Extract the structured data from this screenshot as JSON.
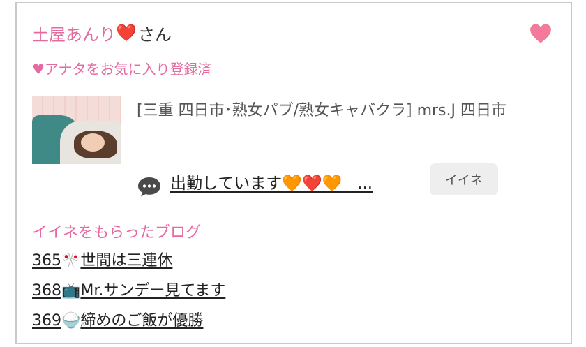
{
  "profile": {
    "name": "土屋あんり",
    "name_emoji": "❤️",
    "suffix": "さん",
    "favorite_status": "♥アナタをお気に入り登録済"
  },
  "shop": {
    "title": "[三重 四日市･熟女パブ/熟女キャバクラ]  mrs.J 四日市"
  },
  "status": {
    "text": "出勤しています🧡❤️🧡   ...",
    "icon": "speech-bubble-icon"
  },
  "like_button": {
    "label": "イイネ"
  },
  "liked_blogs": {
    "heading": "イイネをもらったブログ",
    "items": [
      {
        "number": "365",
        "emoji": "🎌",
        "title": "世間は三連休"
      },
      {
        "number": "368",
        "emoji": "📺",
        "title": "Mr.サンデー見てます"
      },
      {
        "number": "369",
        "emoji": "🍚",
        "title": "締めのご飯が優勝"
      }
    ]
  },
  "colors": {
    "accent_pink": "#e46aa0",
    "heart_pink": "#f47a9b",
    "border": "#c9c9c9",
    "button_bg": "#eeeeee"
  }
}
